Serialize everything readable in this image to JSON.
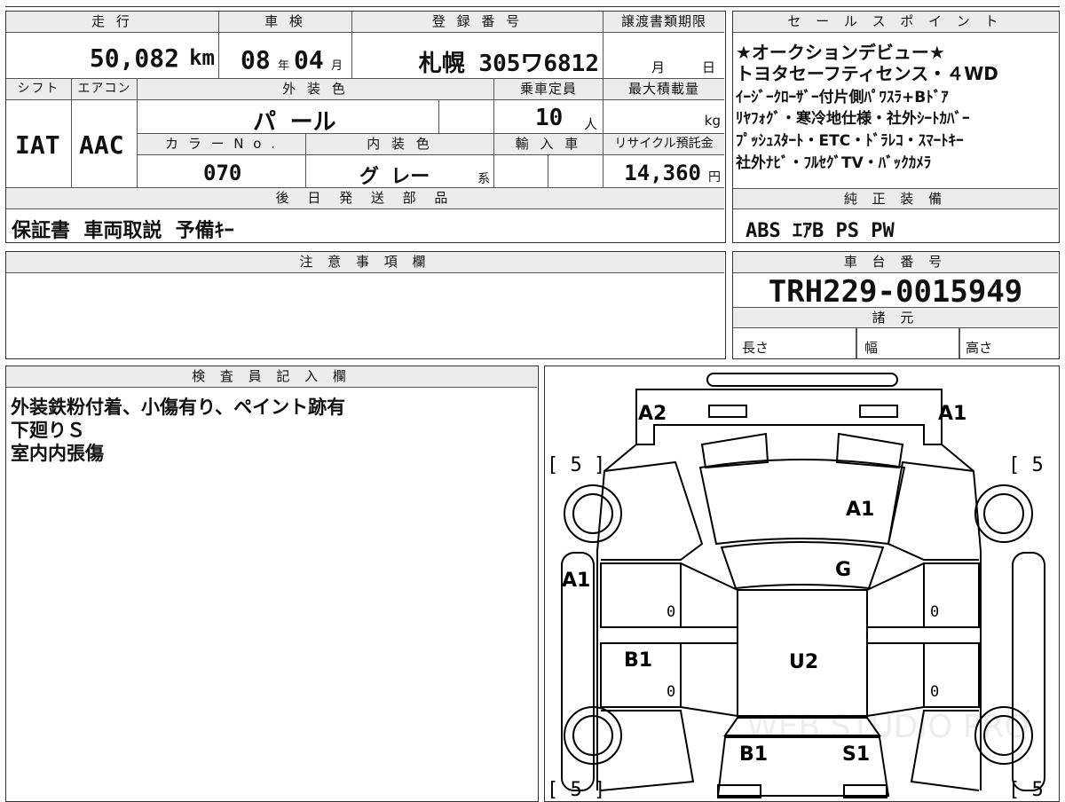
{
  "top": {
    "mileage_label": "走 行",
    "mileage_value": "50,082",
    "mileage_unit": "km",
    "shaken_label": "車 検",
    "shaken_year": "08",
    "shaken_year_unit": "年",
    "shaken_month": "04",
    "shaken_month_unit": "月",
    "reg_label": "登 録 番 号",
    "reg_value": "札幌 305ワ6812",
    "transfer_label": "譲渡書類期限",
    "transfer_month": "月",
    "transfer_day": "日"
  },
  "mid": {
    "shift_label": "シフト",
    "shift_value": "IAT",
    "aircon_label": "エアコン",
    "aircon_value": "AAC",
    "exterior_label": "外 装 色",
    "exterior_value": "パ ール",
    "capacity_label": "乗車定員",
    "capacity_value": "10",
    "capacity_unit": "人",
    "maxload_label": "最大積載量",
    "maxload_unit": "kg",
    "colorno_label": "カ ラ ー N o .",
    "colorno_value": "070",
    "interior_label": "内 装 色",
    "interior_value": "グ レー",
    "interior_unit": "系",
    "import_label": "輸 入 車",
    "recycle_label": "リサイクル預託金",
    "recycle_value": "14,360",
    "recycle_unit": "円"
  },
  "later_parts": {
    "label": "後 日 発 送 部 品",
    "value": "保証書  車両取説  予備ｷｰ"
  },
  "sales": {
    "label": "セ ー ル ス ポ イ ン ト",
    "lines": [
      "★オークションデビュー★",
      "トヨタセーフティセンス・４WD",
      "ｲｰｼﾞｰｸﾛｰｻﾞｰ付片側ﾊﾟﾜｽﾗ+Bﾄﾞｱ",
      "ﾘﾔﾌｫｸﾞ・寒冷地仕様・社外ｼｰﾄｶﾊﾞｰ",
      "ﾌﾟｯｼｭｽﾀｰﾄ・ETC・ﾄﾞﾗﾚｺ・ｽﾏｰﾄｷｰ",
      "社外ﾅﾋﾞ・ﾌﾙｾｸﾞTV・ﾊﾞｯｸｶﾒﾗ"
    ]
  },
  "genuine": {
    "label": "純 正 装 備",
    "value": "ABS ｴｱB PS PW"
  },
  "notes": {
    "label": "注 意 事 項 欄",
    "value": ""
  },
  "chassis": {
    "label": "車 台 番 号",
    "value": "TRH229-0015949",
    "specs_label": "諸 元",
    "length_label": "長さ",
    "width_label": "幅",
    "height_label": "高さ"
  },
  "inspector": {
    "label": "検 査 員 記 入 欄",
    "lines": [
      "外装鉄粉付着、小傷有り、ペイント跡有",
      "下廻りＳ",
      "室内内張傷"
    ]
  },
  "diagram": {
    "marks": {
      "a2_top": "A2",
      "a1_top": "A1",
      "a1_hood": "A1",
      "g_windshield": "G",
      "a1_left": "A1",
      "b1_left": "B1",
      "u2_roof": "U2",
      "b1_rear": "B1",
      "s1_rear": "S1"
    },
    "tire_marks": [
      "[ 5 ]",
      "[ 5 ]",
      "[ 5 ]",
      "[ 5 ]"
    ],
    "zeros": [
      "0",
      "0",
      "0",
      "0"
    ],
    "watermark": "WEB STUDIO PRO"
  }
}
